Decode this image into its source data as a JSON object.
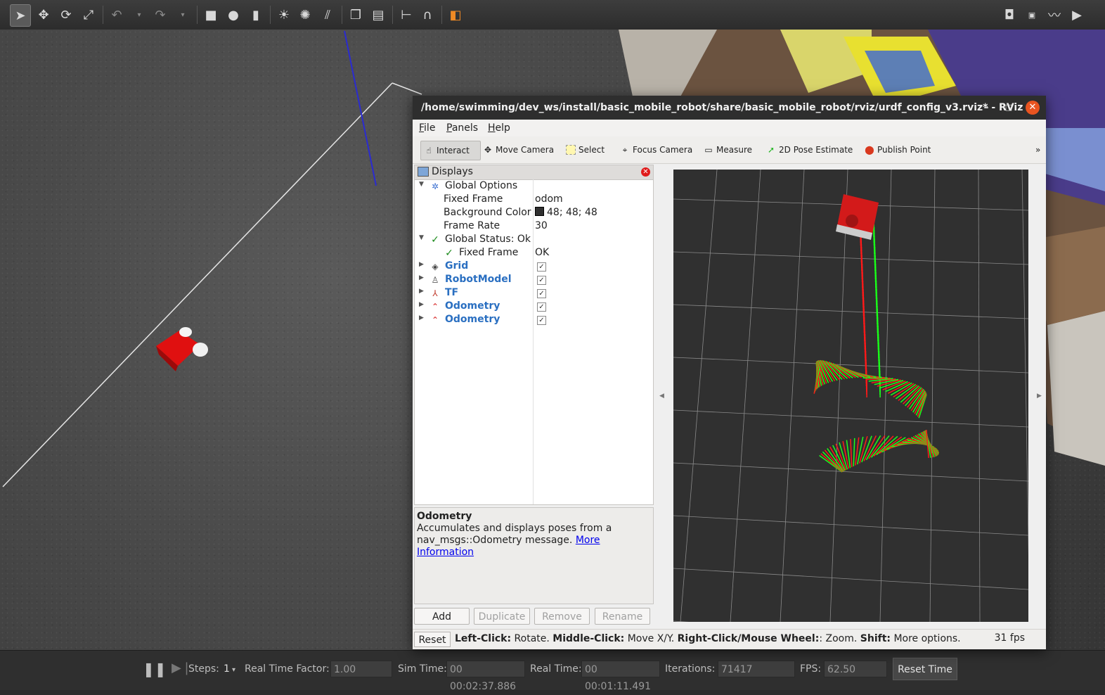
{
  "gazebo": {
    "toolbar_icons": [
      "select-arrow-icon",
      "translate-icon",
      "rotate-icon",
      "scale-icon",
      "undo-icon",
      "redo-icon",
      "box-icon",
      "sphere-icon",
      "cylinder-icon",
      "point-light-icon",
      "spot-light-icon",
      "directional-light-icon",
      "copy-icon",
      "paste-icon",
      "align-icon",
      "magnet-icon",
      "color-icon"
    ],
    "right_icons": [
      "screenshot-icon",
      "log-icon",
      "plot-icon",
      "record-video-icon"
    ],
    "bottom": {
      "steps_label": "Steps:",
      "steps_value": "1",
      "rtf_label": "Real Time Factor:",
      "rtf_value": "1.00",
      "sim_time_label": "Sim Time:",
      "sim_time_value": "00 00:02:37.886",
      "real_time_label": "Real Time:",
      "real_time_value": "00 00:01:11.491",
      "iterations_label": "Iterations:",
      "iterations_value": "71417",
      "fps_label": "FPS:",
      "fps_value": "62.50",
      "reset_time_label": "Reset Time"
    }
  },
  "rviz": {
    "title": "/home/swimming/dev_ws/install/basic_mobile_robot/share/basic_mobile_robot/rviz/urdf_config_v3.rviz* - RViz",
    "menu": [
      "File",
      "Panels",
      "Help"
    ],
    "tools": [
      {
        "label": "Interact"
      },
      {
        "label": "Move Camera"
      },
      {
        "label": "Select"
      },
      {
        "label": "Focus Camera"
      },
      {
        "label": "Measure"
      },
      {
        "label": "2D Pose Estimate"
      },
      {
        "label": "Publish Point"
      }
    ],
    "displays": {
      "header": "Displays",
      "global_options": "Global Options",
      "fixed_frame_label": "Fixed Frame",
      "fixed_frame_value": "odom",
      "background_color_label": "Background Color",
      "background_color_value": "48; 48; 48",
      "frame_rate_label": "Frame Rate",
      "frame_rate_value": "30",
      "global_status": "Global Status: Ok",
      "status_fixed_frame_label": "Fixed Frame",
      "status_fixed_frame_value": "OK",
      "items": [
        {
          "name": "Grid",
          "checked": true
        },
        {
          "name": "RobotModel",
          "checked": true
        },
        {
          "name": "TF",
          "checked": true
        },
        {
          "name": "Odometry",
          "checked": true
        },
        {
          "name": "Odometry",
          "checked": true
        }
      ]
    },
    "description": {
      "title": "Odometry",
      "text": "Accumulates and displays poses from a nav_msgs::Odometry message.",
      "link": "More Information"
    },
    "buttons": {
      "add": "Add",
      "duplicate": "Duplicate",
      "remove": "Remove",
      "rename": "Rename"
    },
    "status": {
      "reset": "Reset",
      "left_click_label": "Left-Click:",
      "left_click_text": "Rotate.",
      "middle_click_label": "Middle-Click:",
      "middle_click_text": "Move X/Y.",
      "right_click_label": "Right-Click/Mouse Wheel:",
      "right_click_text": ": Zoom.",
      "shift_label": "Shift:",
      "shift_text": "More options.",
      "fps": "31 fps"
    },
    "colors": {
      "background": "#303030",
      "odom_red": "#ff1a1a",
      "odom_green": "#1aff1a"
    }
  }
}
